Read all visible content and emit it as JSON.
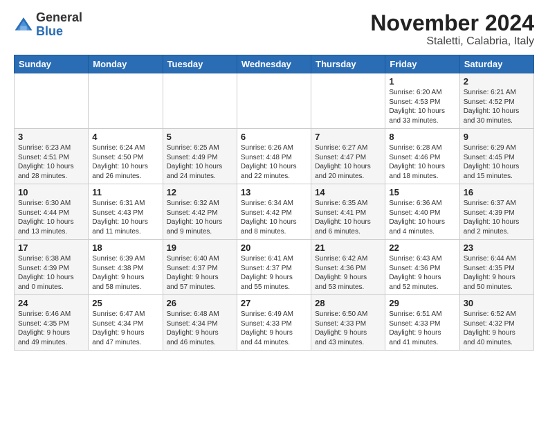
{
  "logo": {
    "text_line1": "General",
    "text_line2": "Blue"
  },
  "title": "November 2024",
  "subtitle": "Staletti, Calabria, Italy",
  "days_of_week": [
    "Sunday",
    "Monday",
    "Tuesday",
    "Wednesday",
    "Thursday",
    "Friday",
    "Saturday"
  ],
  "weeks": [
    [
      {
        "day": "",
        "info": ""
      },
      {
        "day": "",
        "info": ""
      },
      {
        "day": "",
        "info": ""
      },
      {
        "day": "",
        "info": ""
      },
      {
        "day": "",
        "info": ""
      },
      {
        "day": "1",
        "info": "Sunrise: 6:20 AM\nSunset: 4:53 PM\nDaylight: 10 hours\nand 33 minutes."
      },
      {
        "day": "2",
        "info": "Sunrise: 6:21 AM\nSunset: 4:52 PM\nDaylight: 10 hours\nand 30 minutes."
      }
    ],
    [
      {
        "day": "3",
        "info": "Sunrise: 6:23 AM\nSunset: 4:51 PM\nDaylight: 10 hours\nand 28 minutes."
      },
      {
        "day": "4",
        "info": "Sunrise: 6:24 AM\nSunset: 4:50 PM\nDaylight: 10 hours\nand 26 minutes."
      },
      {
        "day": "5",
        "info": "Sunrise: 6:25 AM\nSunset: 4:49 PM\nDaylight: 10 hours\nand 24 minutes."
      },
      {
        "day": "6",
        "info": "Sunrise: 6:26 AM\nSunset: 4:48 PM\nDaylight: 10 hours\nand 22 minutes."
      },
      {
        "day": "7",
        "info": "Sunrise: 6:27 AM\nSunset: 4:47 PM\nDaylight: 10 hours\nand 20 minutes."
      },
      {
        "day": "8",
        "info": "Sunrise: 6:28 AM\nSunset: 4:46 PM\nDaylight: 10 hours\nand 18 minutes."
      },
      {
        "day": "9",
        "info": "Sunrise: 6:29 AM\nSunset: 4:45 PM\nDaylight: 10 hours\nand 15 minutes."
      }
    ],
    [
      {
        "day": "10",
        "info": "Sunrise: 6:30 AM\nSunset: 4:44 PM\nDaylight: 10 hours\nand 13 minutes."
      },
      {
        "day": "11",
        "info": "Sunrise: 6:31 AM\nSunset: 4:43 PM\nDaylight: 10 hours\nand 11 minutes."
      },
      {
        "day": "12",
        "info": "Sunrise: 6:32 AM\nSunset: 4:42 PM\nDaylight: 10 hours\nand 9 minutes."
      },
      {
        "day": "13",
        "info": "Sunrise: 6:34 AM\nSunset: 4:42 PM\nDaylight: 10 hours\nand 8 minutes."
      },
      {
        "day": "14",
        "info": "Sunrise: 6:35 AM\nSunset: 4:41 PM\nDaylight: 10 hours\nand 6 minutes."
      },
      {
        "day": "15",
        "info": "Sunrise: 6:36 AM\nSunset: 4:40 PM\nDaylight: 10 hours\nand 4 minutes."
      },
      {
        "day": "16",
        "info": "Sunrise: 6:37 AM\nSunset: 4:39 PM\nDaylight: 10 hours\nand 2 minutes."
      }
    ],
    [
      {
        "day": "17",
        "info": "Sunrise: 6:38 AM\nSunset: 4:39 PM\nDaylight: 10 hours\nand 0 minutes."
      },
      {
        "day": "18",
        "info": "Sunrise: 6:39 AM\nSunset: 4:38 PM\nDaylight: 9 hours\nand 58 minutes."
      },
      {
        "day": "19",
        "info": "Sunrise: 6:40 AM\nSunset: 4:37 PM\nDaylight: 9 hours\nand 57 minutes."
      },
      {
        "day": "20",
        "info": "Sunrise: 6:41 AM\nSunset: 4:37 PM\nDaylight: 9 hours\nand 55 minutes."
      },
      {
        "day": "21",
        "info": "Sunrise: 6:42 AM\nSunset: 4:36 PM\nDaylight: 9 hours\nand 53 minutes."
      },
      {
        "day": "22",
        "info": "Sunrise: 6:43 AM\nSunset: 4:36 PM\nDaylight: 9 hours\nand 52 minutes."
      },
      {
        "day": "23",
        "info": "Sunrise: 6:44 AM\nSunset: 4:35 PM\nDaylight: 9 hours\nand 50 minutes."
      }
    ],
    [
      {
        "day": "24",
        "info": "Sunrise: 6:46 AM\nSunset: 4:35 PM\nDaylight: 9 hours\nand 49 minutes."
      },
      {
        "day": "25",
        "info": "Sunrise: 6:47 AM\nSunset: 4:34 PM\nDaylight: 9 hours\nand 47 minutes."
      },
      {
        "day": "26",
        "info": "Sunrise: 6:48 AM\nSunset: 4:34 PM\nDaylight: 9 hours\nand 46 minutes."
      },
      {
        "day": "27",
        "info": "Sunrise: 6:49 AM\nSunset: 4:33 PM\nDaylight: 9 hours\nand 44 minutes."
      },
      {
        "day": "28",
        "info": "Sunrise: 6:50 AM\nSunset: 4:33 PM\nDaylight: 9 hours\nand 43 minutes."
      },
      {
        "day": "29",
        "info": "Sunrise: 6:51 AM\nSunset: 4:33 PM\nDaylight: 9 hours\nand 41 minutes."
      },
      {
        "day": "30",
        "info": "Sunrise: 6:52 AM\nSunset: 4:32 PM\nDaylight: 9 hours\nand 40 minutes."
      }
    ]
  ]
}
